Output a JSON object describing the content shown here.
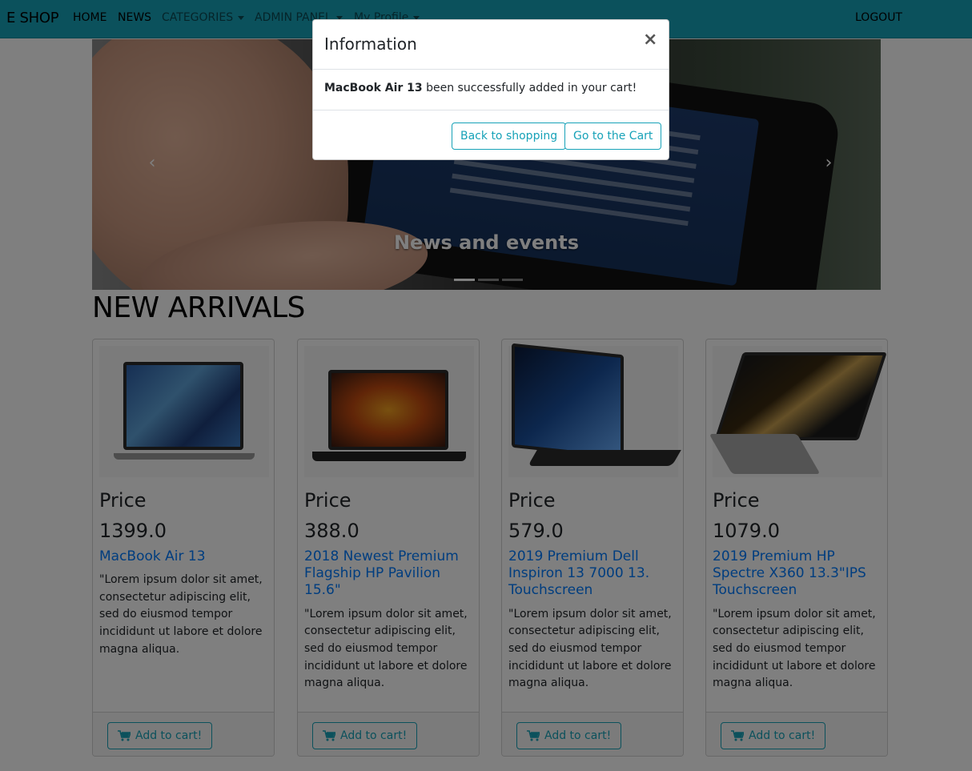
{
  "navbar": {
    "brand": "E SHOP",
    "items": [
      {
        "label": "HOME"
      },
      {
        "label": "NEWS"
      },
      {
        "label": "CATEGORIES"
      },
      {
        "label": "ADMIN PANEL"
      },
      {
        "label": "My Profile"
      }
    ],
    "logout": "LOGOUT"
  },
  "carousel": {
    "caption": "News and events",
    "prev_icon": "chevron-left-icon",
    "next_icon": "chevron-right-icon"
  },
  "section_title": "NEW ARRIVALS",
  "products": [
    {
      "price_label": "Price",
      "price": "1399.0",
      "name": "MacBook Air 13",
      "description": "\"Lorem ipsum dolor sit amet, consectetur adipiscing elit, sed do eiusmod tempor incididunt ut labore et dolore magna aliqua.",
      "button": "Add to cart!"
    },
    {
      "price_label": "Price",
      "price": "388.0",
      "name": "2018 Newest Premium Flagship HP Pavilion 15.6\"",
      "description": "\"Lorem ipsum dolor sit amet, consectetur adipiscing elit, sed do eiusmod tempor incididunt ut labore et dolore magna aliqua.",
      "button": "Add to cart!"
    },
    {
      "price_label": "Price",
      "price": "579.0",
      "name": "2019 Premium Dell Inspiron 13 7000 13. Touchscreen",
      "description": "\"Lorem ipsum dolor sit amet, consectetur adipiscing elit, sed do eiusmod tempor incididunt ut labore et dolore magna aliqua.",
      "button": "Add to cart!"
    },
    {
      "price_label": "Price",
      "price": "1079.0",
      "name": "2019 Premium HP Spectre X360 13.3\"IPS Touchscreen",
      "description": "\"Lorem ipsum dolor sit amet, consectetur adipiscing elit, sed do eiusmod tempor incididunt ut labore et dolore magna aliqua.",
      "button": "Add to cart!"
    }
  ],
  "modal": {
    "title": "Information",
    "product": "MacBook Air 13",
    "message": " been successfully added in your cart!",
    "back_button": "Back to shopping",
    "cart_button": "Go to the Cart",
    "close_icon": "close-icon"
  },
  "colors": {
    "navbar": "#17a2b8",
    "link": "#007bff",
    "accent": "#17a2b8"
  }
}
